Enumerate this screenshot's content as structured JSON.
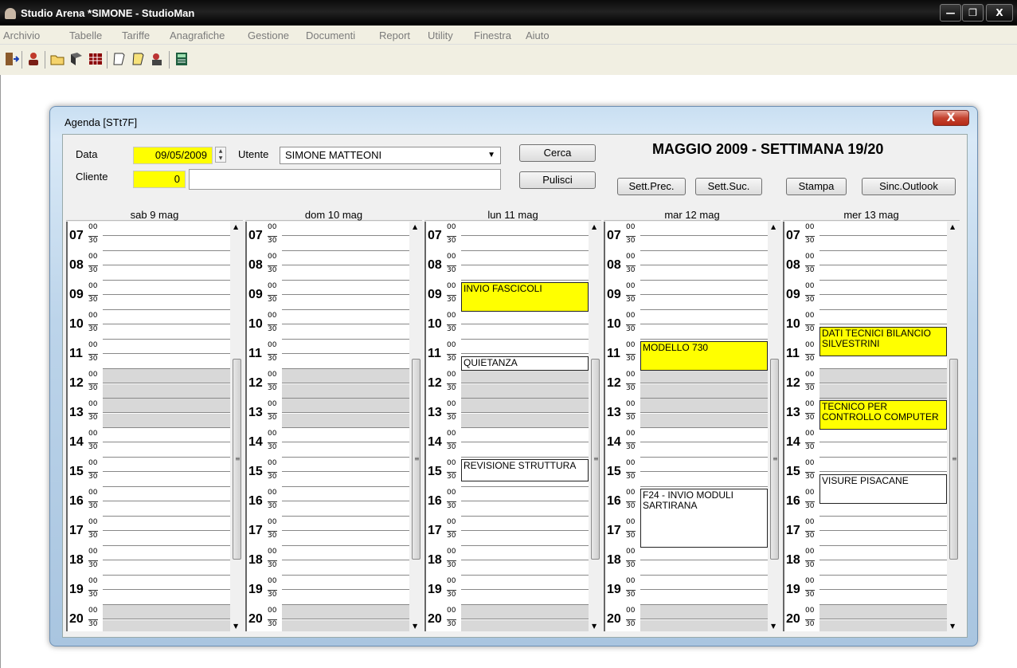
{
  "window": {
    "title": "Studio Arena *SIMONE - StudioMan"
  },
  "menu": [
    "Archivio",
    "Tabelle",
    "Tariffe",
    "Anagrafiche",
    "Gestione",
    "Documenti",
    "Report",
    "Utility",
    "Finestra",
    "Aiuto"
  ],
  "agenda": {
    "title": "Agenda  [STt7F]",
    "data_label": "Data",
    "data_value": "09/05/2009",
    "utente_label": "Utente",
    "utente_value": "SIMONE MATTEONI",
    "cliente_label": "Cliente",
    "cliente_value": "0",
    "cerca": "Cerca",
    "pulisci": "Pulisci",
    "heading": "MAGGIO 2009 - SETTIMANA 19/20",
    "sett_prec": "Sett.Prec.",
    "sett_suc": "Sett.Suc.",
    "stampa": "Stampa",
    "sinc": "Sinc.Outlook",
    "hours": [
      "07",
      "08",
      "09",
      "10",
      "11",
      "12",
      "13",
      "14",
      "15",
      "16",
      "17",
      "18",
      "19",
      "20"
    ],
    "min00": "00",
    "min30": "30",
    "days": [
      {
        "label": "sab 9 mag",
        "appointments": []
      },
      {
        "label": "dom 10 mag",
        "appointments": []
      },
      {
        "label": "lun 11 mag",
        "appointments": [
          {
            "text": "INVIO FASCICOLI",
            "color": "yellow",
            "start": "09:00",
            "end": "10:00"
          },
          {
            "text": "QUIETANZA",
            "color": "white",
            "start": "11:30",
            "end": "12:00"
          },
          {
            "text": "REVISIONE STRUTTURA",
            "color": "white",
            "start": "15:00",
            "end": "15:45"
          }
        ]
      },
      {
        "label": "mar 12 mag",
        "appointments": [
          {
            "text": "MODELLO 730",
            "color": "yellow",
            "start": "11:00",
            "end": "12:00"
          },
          {
            "text": "F24 - INVIO MODULI SARTIRANA",
            "color": "white",
            "start": "16:00",
            "end": "18:00"
          }
        ]
      },
      {
        "label": "mer 13 mag",
        "appointments": [
          {
            "text": "DATI TECNICI BILANCIO SILVESTRINI",
            "color": "yellow",
            "start": "10:30",
            "end": "11:30"
          },
          {
            "text": "TECNICO PER CONTROLLO COMPUTER",
            "color": "yellow",
            "start": "13:00",
            "end": "14:00"
          },
          {
            "text": "VISURE PISACANE",
            "color": "white",
            "start": "15:30",
            "end": "16:30"
          }
        ]
      }
    ]
  }
}
